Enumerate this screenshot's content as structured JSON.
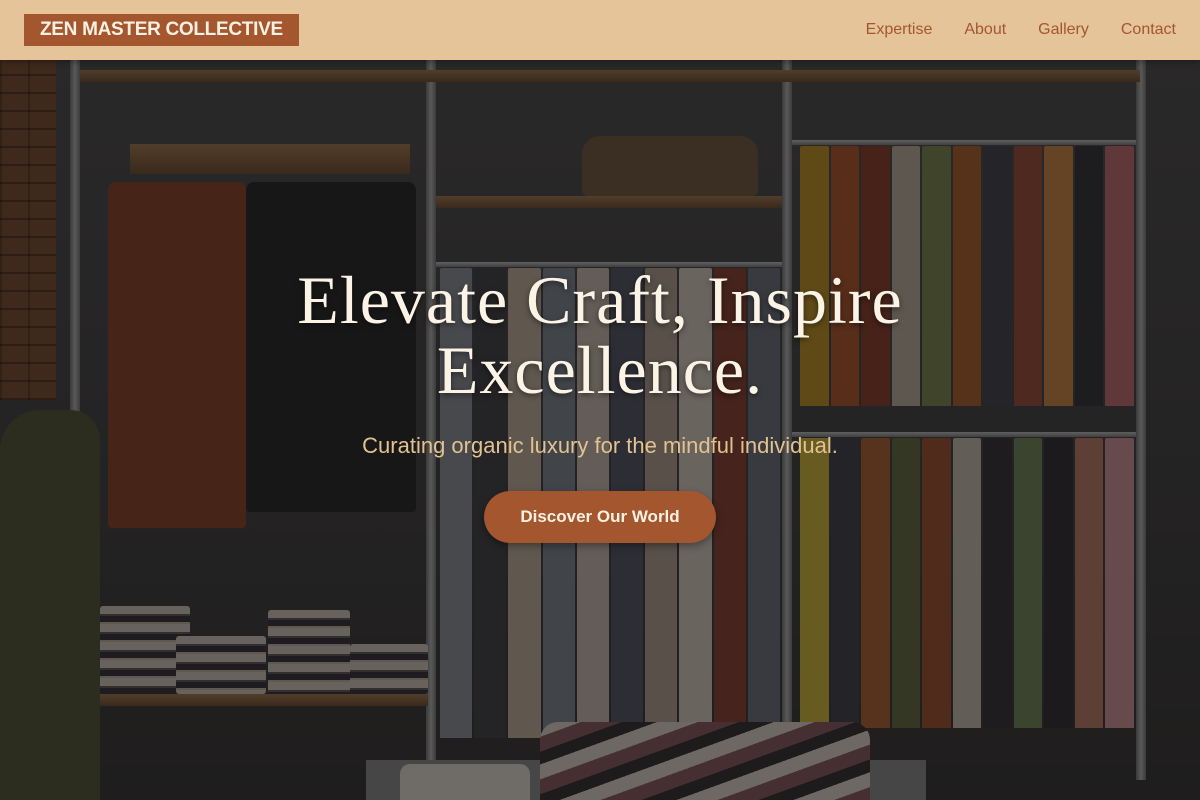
{
  "brand": {
    "name": "ZEN MASTER COLLECTIVE"
  },
  "nav": {
    "items": [
      {
        "label": "Expertise"
      },
      {
        "label": "About"
      },
      {
        "label": "Gallery"
      },
      {
        "label": "Contact"
      }
    ]
  },
  "hero": {
    "title": "Elevate Craft, Inspire Excellence.",
    "subtitle": "Curating organic luxury for the mindful individual.",
    "cta_label": "Discover Our World"
  },
  "colors": {
    "header_bg": "#e5c49a",
    "accent": "#a4562f",
    "title_text": "#fbf3e6",
    "subtitle_text": "#e2c291"
  },
  "background_image": {
    "subject": "clothing-store-interior-photo"
  }
}
